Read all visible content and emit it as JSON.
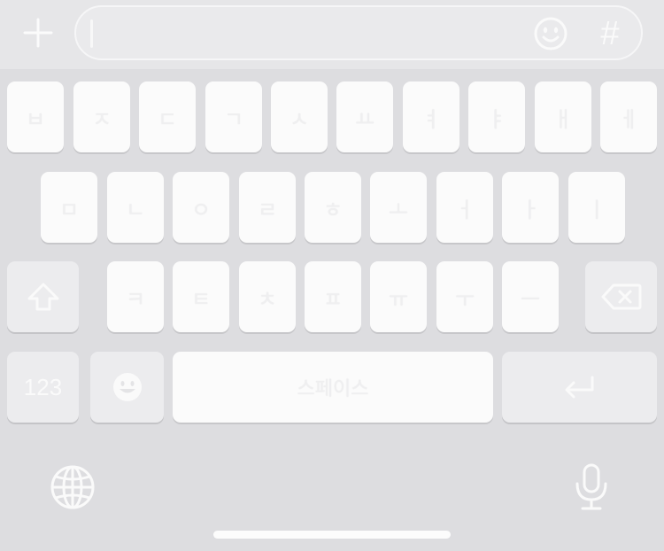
{
  "input": {
    "placeholder": "",
    "value": ""
  },
  "toolbar": {
    "plus_icon": "plus-icon",
    "emoji_icon": "smiley-icon",
    "hash_label": "#"
  },
  "keyboard": {
    "row1": [
      "ㅂ",
      "ㅈ",
      "ㄷ",
      "ㄱ",
      "ㅅ",
      "ㅛ",
      "ㅕ",
      "ㅑ",
      "ㅐ",
      "ㅔ"
    ],
    "row2": [
      "ㅁ",
      "ㄴ",
      "ㅇ",
      "ㄹ",
      "ㅎ",
      "ㅗ",
      "ㅓ",
      "ㅏ",
      "ㅣ"
    ],
    "row3": [
      "ㅋ",
      "ㅌ",
      "ㅊ",
      "ㅍ",
      "ㅠ",
      "ㅜ",
      "ㅡ"
    ],
    "shift_icon": "shift-icon",
    "delete_icon": "delete-icon",
    "numbers_label": "123",
    "emoji_key_icon": "emoji-face-icon",
    "space_label": "스페이스",
    "return_icon": "return-icon"
  },
  "system": {
    "globe_icon": "globe-icon",
    "mic_icon": "microphone-icon"
  },
  "colors": {
    "background": "#dddde0",
    "key": "#fbfbfb",
    "key_dark": "#ececee",
    "glyph": "#efeff0"
  }
}
